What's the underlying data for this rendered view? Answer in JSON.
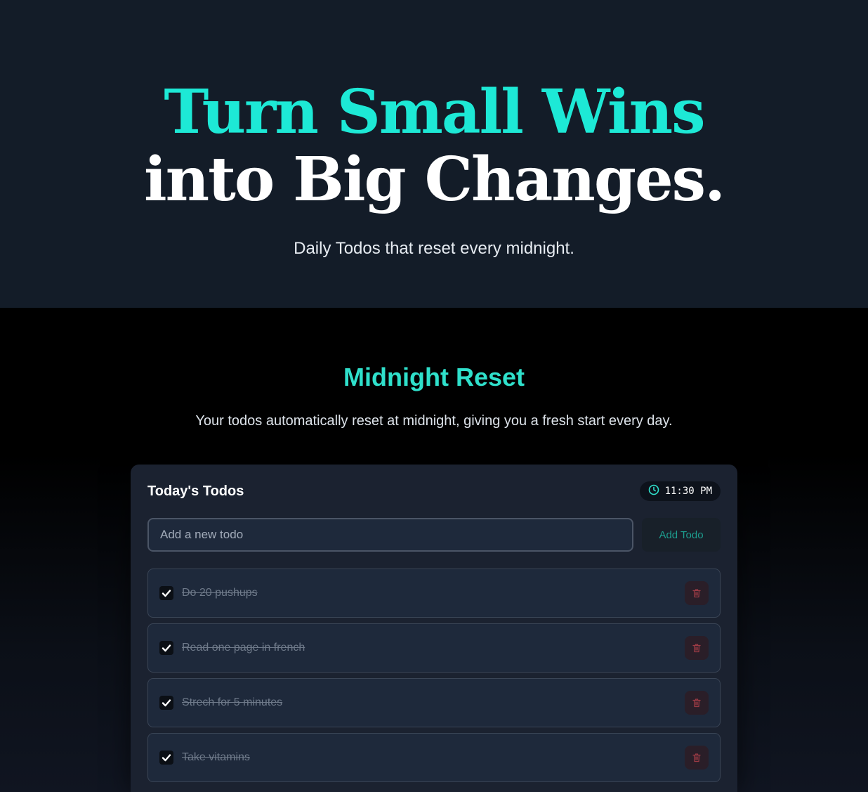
{
  "hero": {
    "headline_line1": "Turn Small Wins",
    "headline_line2": "into Big Changes.",
    "tagline": "Daily Todos that reset every midnight."
  },
  "section": {
    "title": "Midnight Reset",
    "description": "Your todos automatically reset at midnight, giving you a fresh start every day."
  },
  "card": {
    "title": "Today's Todos",
    "clock_time": "11:30 PM",
    "input_placeholder": "Add a new todo",
    "add_button_label": "Add Todo",
    "todos": [
      {
        "text": "Do 20 pushups",
        "done": true
      },
      {
        "text": "Read one page in french",
        "done": true
      },
      {
        "text": "Strech for 5 minutes",
        "done": true
      },
      {
        "text": "Take vitamins",
        "done": true
      }
    ]
  },
  "icons": {
    "clock": "clock-icon",
    "check": "check-icon",
    "delete": "trash-icon"
  },
  "colors": {
    "accent": "#1de9d6",
    "hero_bg": "#131c28",
    "card_bg": "#1b2230",
    "delete": "#9b3b45"
  }
}
